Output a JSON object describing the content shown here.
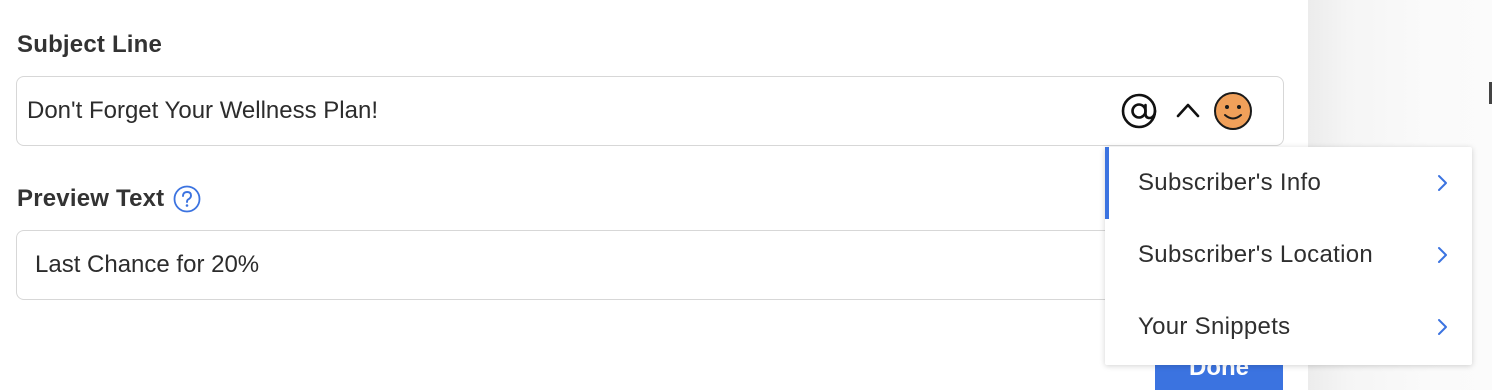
{
  "subject": {
    "label": "Subject Line",
    "value": "Don't Forget Your Wellness Plan!",
    "icons": [
      "at-icon",
      "caret-up-icon",
      "emoji-smiley-icon"
    ]
  },
  "preview": {
    "label": "Preview Text",
    "value": "Last Chance for 20%",
    "help_icon": "question-circle-icon"
  },
  "menu": {
    "items": [
      {
        "label": "Subscriber's Info",
        "icon": "chevron-right-icon",
        "active": true
      },
      {
        "label": "Subscriber's Location",
        "icon": "chevron-right-icon",
        "active": false
      },
      {
        "label": "Your Snippets",
        "icon": "chevron-right-icon",
        "active": false
      }
    ]
  },
  "footer": {
    "done_label": "Done"
  },
  "colors": {
    "accent": "#3b73e0",
    "emoji": "#f0a05a",
    "text": "#2c2c2c",
    "border": "#d7d7d7"
  }
}
